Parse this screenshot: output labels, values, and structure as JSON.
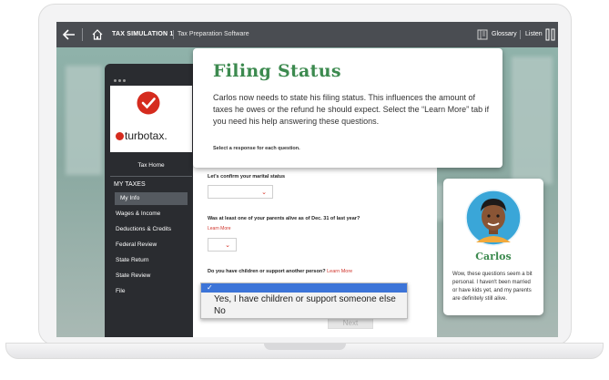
{
  "header": {
    "title": "TAX SIMULATION 1",
    "subtitle": "Tax Preparation Software",
    "glossary": "Glossary",
    "listen": "Listen"
  },
  "sidebar": {
    "brand": "turbotax.",
    "items": [
      {
        "label": "Tax Home"
      },
      {
        "label": "MY TAXES"
      },
      {
        "label": "My Info"
      },
      {
        "label": "Wages & Income"
      },
      {
        "label": "Deductions & Credits"
      },
      {
        "label": "Federal Review"
      },
      {
        "label": "State Return"
      },
      {
        "label": "State Review"
      },
      {
        "label": "File"
      }
    ]
  },
  "card": {
    "title": "Filing Status",
    "body": "Carlos now needs to state his filing status. This influences the amount of taxes he owes or the refund he should expect. Select the “Learn More” tab if you need his help answering these questions.",
    "instruction": "Select a response for each question."
  },
  "form": {
    "q1": "Let's confirm your marital status",
    "q2": "Was at least one of your parents alive as of Dec. 31 of last year?",
    "q2_learn": "Learn More",
    "q3": "Do you have children or support another person?",
    "q3_learn": "Learn More",
    "next": "Next"
  },
  "dropdown": {
    "selected": "✓",
    "options": [
      "Yes, I have children or support someone else",
      "No"
    ]
  },
  "character": {
    "name": "Carlos",
    "quote": "Wow, these questions seem a bit personal. I haven't been married or have kids yet, and my parents are definitely still alive."
  },
  "colors": {
    "accent_green": "#3c8a4f",
    "turbotax_red": "#d52b1e",
    "dropdown_highlight": "#3c74d8"
  }
}
